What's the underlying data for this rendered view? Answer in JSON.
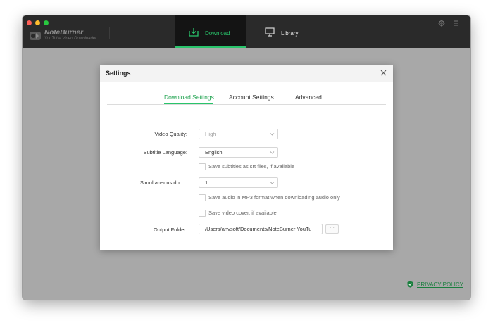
{
  "app": {
    "name": "NoteBurner",
    "subtitle": "YouTube Video Downloader"
  },
  "tabs": {
    "download": "Download",
    "library": "Library"
  },
  "settings": {
    "title": "Settings",
    "tabs": [
      "Download Settings",
      "Account Settings",
      "Advanced"
    ],
    "active_tab": "Download Settings",
    "video_quality": {
      "label": "Video Quality:",
      "value": "High"
    },
    "subtitle_language": {
      "label": "Subtitle Language:",
      "value": "English"
    },
    "save_srt": {
      "label": "Save subtitles as srt files, if available",
      "checked": false
    },
    "simultaneous": {
      "label": "Simultaneous do...",
      "value": "1"
    },
    "save_mp3": {
      "label": "Save audio in MP3 format when downloading audio only",
      "checked": false
    },
    "save_cover": {
      "label": "Save video cover, if available",
      "checked": false
    },
    "output_folder": {
      "label": "Output Folder:",
      "value": "/Users/anvsoft/Documents/NoteBurner YouTu",
      "browse": "···"
    }
  },
  "footer": {
    "privacy": "PRIVACY POLICY"
  },
  "colors": {
    "accent": "#29c46b",
    "titlebar": "#2a2a2a",
    "backdrop": "#a8a8a8"
  },
  "icons": {
    "download_tab": "download-tray-icon",
    "library_tab": "monitor-icon",
    "settings": "gear-icon",
    "menu": "hamburger-menu-icon",
    "close": "close-icon",
    "privacy": "shield-icon"
  }
}
